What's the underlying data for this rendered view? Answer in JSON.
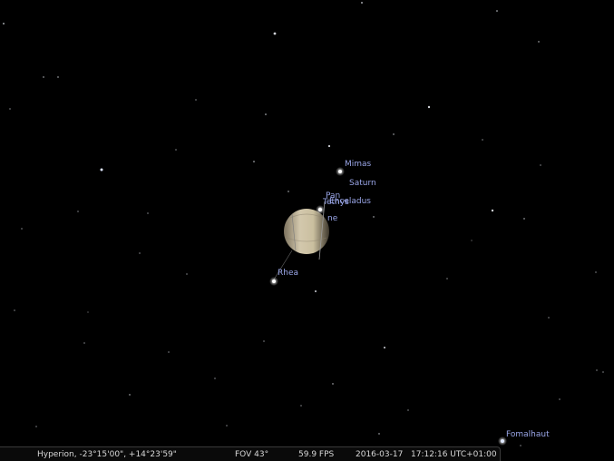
{
  "sky_labels": {
    "mimas": "Mimas",
    "saturn": "Saturn",
    "pan": "Pan",
    "tethys": "Tethys",
    "enceladus": "Enceladus",
    "partial": "ne",
    "rhea": "Rhea",
    "fomalhaut": "Fomalhaut"
  },
  "status_bar": {
    "location": "Hyperion, -23°15'00\", +14°23'59\"",
    "fov": "FOV 43°",
    "fps": "59.9 FPS",
    "date": "2016-03-17",
    "time": "17:12:16 UTC+01:00"
  },
  "colors": {
    "sky": "#000000",
    "label": "#9aa6e8",
    "saturn_light": "#d8cfb6",
    "saturn_dark": "#6e6452"
  }
}
